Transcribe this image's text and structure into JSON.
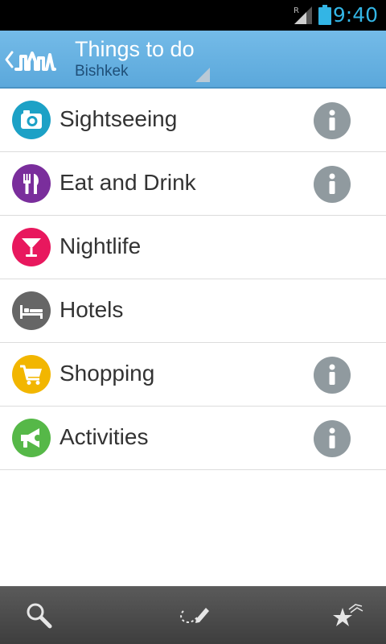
{
  "status_bar": {
    "time": "9:40",
    "roaming_indicator": "R",
    "icons": [
      "signal-icon",
      "battery-icon"
    ]
  },
  "action_bar": {
    "title": "Things to do",
    "subtitle": "Bishkek",
    "icons": [
      "back-chevron-icon",
      "city-skyline-logo-icon",
      "spinner-corner-icon"
    ],
    "accent_color": "#6cb6e4"
  },
  "categories": [
    {
      "label": "Sightseeing",
      "icon": "camera-icon",
      "color": "#1ca1c6",
      "has_info": true
    },
    {
      "label": "Eat and Drink",
      "icon": "fork-knife-icon",
      "color": "#7a2e9c",
      "has_info": true
    },
    {
      "label": "Nightlife",
      "icon": "cocktail-icon",
      "color": "#e8185e",
      "has_info": false
    },
    {
      "label": "Hotels",
      "icon": "bed-icon",
      "color": "#666666",
      "has_info": false
    },
    {
      "label": "Shopping",
      "icon": "shopping-cart-icon",
      "color": "#f2b600",
      "has_info": true
    },
    {
      "label": "Activities",
      "icon": "megaphone-icon",
      "color": "#56b848",
      "has_info": true
    }
  ],
  "info_icon": "info-icon",
  "bottom_bar": {
    "buttons": [
      "search-icon",
      "route-pencil-icon",
      "favorites-stars-icon"
    ]
  }
}
